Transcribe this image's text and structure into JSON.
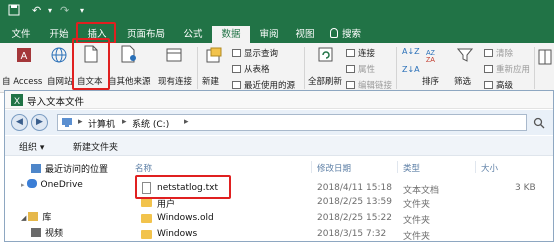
{
  "quick_access": {
    "save_icon": "save-icon",
    "undo_icon": "undo-icon",
    "redo_icon": "redo-icon",
    "customize_icon": "customize-icon"
  },
  "tabs": [
    {
      "label": "文件",
      "active": false
    },
    {
      "label": "开始",
      "active": false
    },
    {
      "label": "插入",
      "active": false
    },
    {
      "label": "页面布局",
      "active": false
    },
    {
      "label": "公式",
      "active": false
    },
    {
      "label": "数据",
      "active": true
    },
    {
      "label": "审阅",
      "active": false
    },
    {
      "label": "视图",
      "active": false
    }
  ],
  "tell_me": "搜索",
  "ribbon": {
    "from_access": "自 Access",
    "from_web": "自网站",
    "from_text": "自文本",
    "from_other": "自其他来源",
    "existing_connections": "现有连接",
    "new_query": "新建\n查询",
    "show_queries": "显示查询",
    "from_table": "从表格",
    "recent_sources": "最近使用的源",
    "refresh_all": "全部刷新",
    "connections": "连接",
    "properties": "属性",
    "edit_links": "编辑链接",
    "sort": "排序",
    "filter": "筛选",
    "clear": "清除",
    "reapply": "重新应用",
    "advanced": "高级"
  },
  "dialog": {
    "title": "导入文本文件",
    "breadcrumbs": [
      "计算机",
      "系统 (C:)"
    ],
    "commands": {
      "organize": "组织 ▾",
      "new_folder": "新建文件夹"
    },
    "nav": [
      {
        "label": "最近访问的位置",
        "icon": "recent-places-icon"
      },
      {
        "label": "OneDrive",
        "icon": "onedrive-icon"
      },
      {
        "label": "库",
        "icon": "library-icon"
      },
      {
        "label": "视频",
        "icon": "video-icon"
      }
    ],
    "columns": {
      "name": "名称",
      "modified": "修改日期",
      "type": "类型",
      "size": "大小"
    },
    "files": [
      {
        "name": "netstatlog.txt",
        "modified": "2018/4/11 15:18",
        "type": "文本文档",
        "size": "3 KB",
        "kind": "file"
      },
      {
        "name": "用户",
        "modified": "2018/2/25 13:59",
        "type": "文件夹",
        "size": "",
        "kind": "folder"
      },
      {
        "name": "Windows.old",
        "modified": "2018/2/25 15:22",
        "type": "文件夹",
        "size": "",
        "kind": "folder"
      },
      {
        "name": "Windows",
        "modified": "2018/3/15 7:32",
        "type": "文件夹",
        "size": "",
        "kind": "folder"
      }
    ]
  }
}
